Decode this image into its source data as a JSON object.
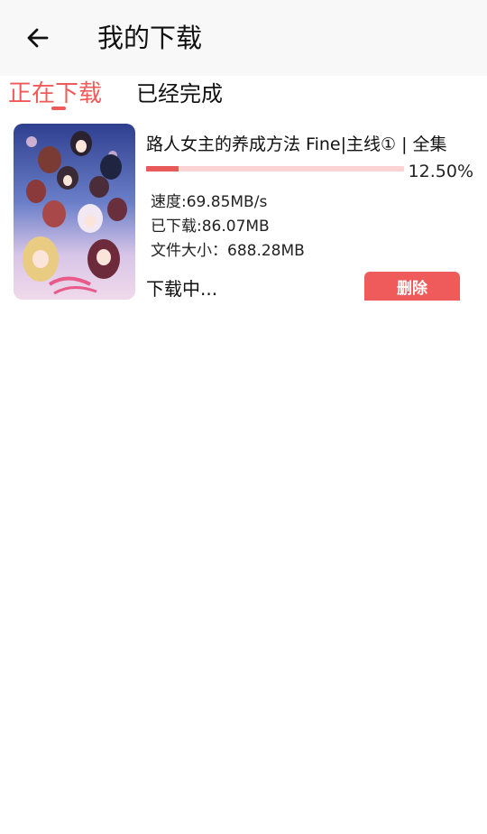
{
  "header": {
    "back_icon": "arrow-left-icon",
    "title": "我的下载"
  },
  "tabs": [
    {
      "label": "正在下载",
      "active": true
    },
    {
      "label": "已经完成",
      "active": false
    }
  ],
  "colors": {
    "accent": "#ef5a5a",
    "progress_track": "#fbd3d3",
    "appbar_bg": "#f8f8f8"
  },
  "download_item": {
    "title": "路人女主的养成方法 Fine|主线① | 全集",
    "progress_fraction": 0.125,
    "percent_text": "12.50%",
    "speed": "速度:69.85MB/s",
    "downloaded": "已下载:86.07MB",
    "file_size": "文件大小：688.28MB",
    "status": "下载中...",
    "delete_label": "删除"
  }
}
